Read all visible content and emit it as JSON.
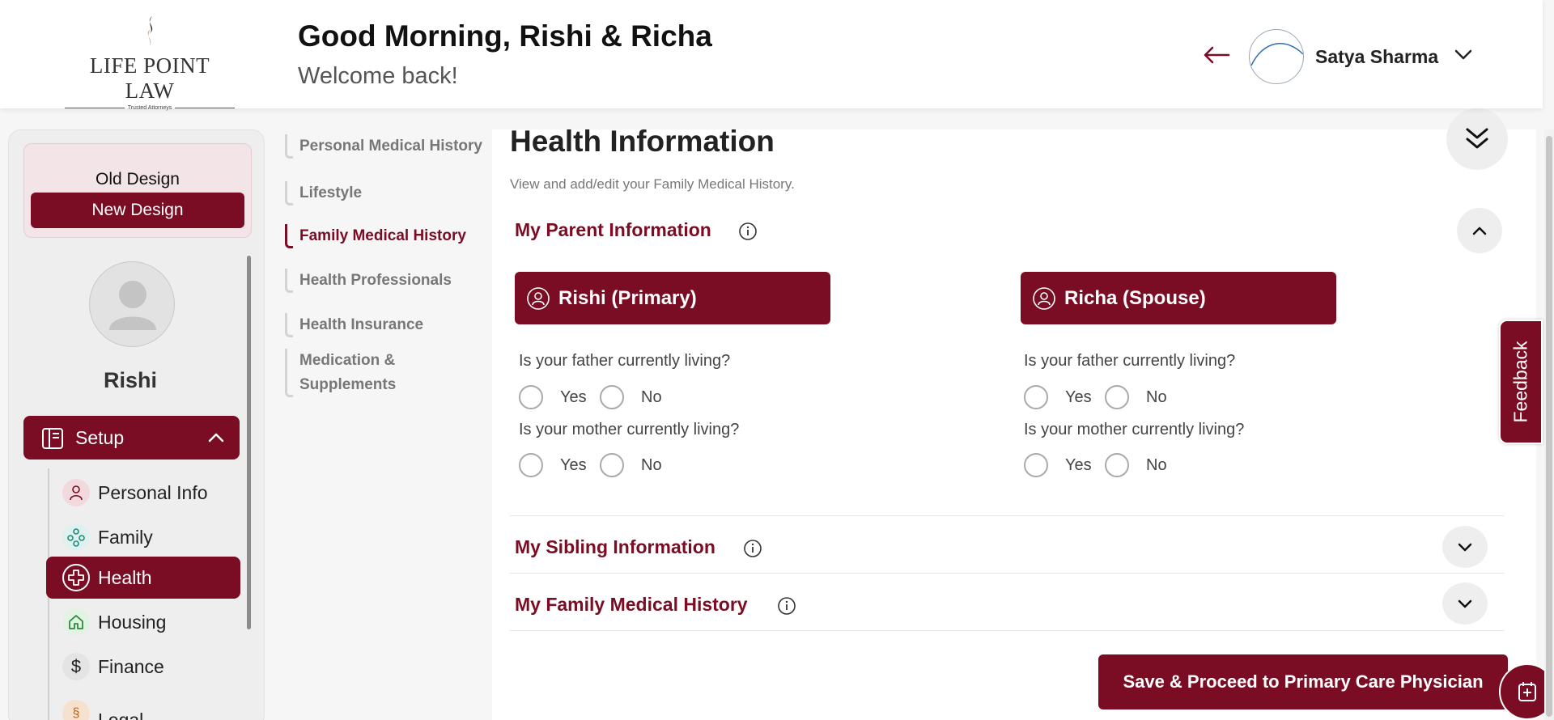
{
  "header": {
    "logo": {
      "name": "LIFE POINT LAW",
      "tagline": "Trusted Attorneys"
    },
    "greeting": "Good Morning, Rishi & Richa",
    "welcome": "Welcome back!",
    "user_name": "Satya Sharma"
  },
  "sidebar": {
    "old_design": "Old Design",
    "new_design": "New Design",
    "profile_name": "Rishi",
    "setup_label": "Setup",
    "items": [
      {
        "label": "Personal Info",
        "icon": "person-icon"
      },
      {
        "label": "Family",
        "icon": "family-icon"
      },
      {
        "label": "Health",
        "icon": "health-cross-icon",
        "active": true
      },
      {
        "label": "Housing",
        "icon": "home-icon"
      },
      {
        "label": "Finance",
        "icon": "dollar-icon"
      },
      {
        "label": "Legal",
        "icon": "legal-icon"
      }
    ]
  },
  "subnav": {
    "items": [
      {
        "label": "Personal Medical History"
      },
      {
        "label": "Lifestyle"
      },
      {
        "label": "Family Medical History",
        "active": true
      },
      {
        "label": "Health Professionals"
      },
      {
        "label": "Health Insurance"
      },
      {
        "label": "Medication & Supplements"
      }
    ]
  },
  "main": {
    "title": "Health Information",
    "subtitle": "View and add/edit your Family Medical History.",
    "sections": {
      "parent": "My Parent Information",
      "sibling": "My Sibling Information",
      "family_history": "My Family Medical History"
    },
    "persons": [
      {
        "name": "Rishi (Primary)",
        "q_father": "Is your father currently living?",
        "q_mother": "Is your mother currently living?"
      },
      {
        "name": "Richa (Spouse)",
        "q_father": "Is your father currently living?",
        "q_mother": "Is your mother currently living?"
      }
    ],
    "yes": "Yes",
    "no": "No",
    "save_button": "Save & Proceed to Primary Care Physician"
  },
  "feedback_label": "Feedback",
  "colors": {
    "brand": "#7a0c23",
    "brand_light": "#f3e5e7"
  }
}
